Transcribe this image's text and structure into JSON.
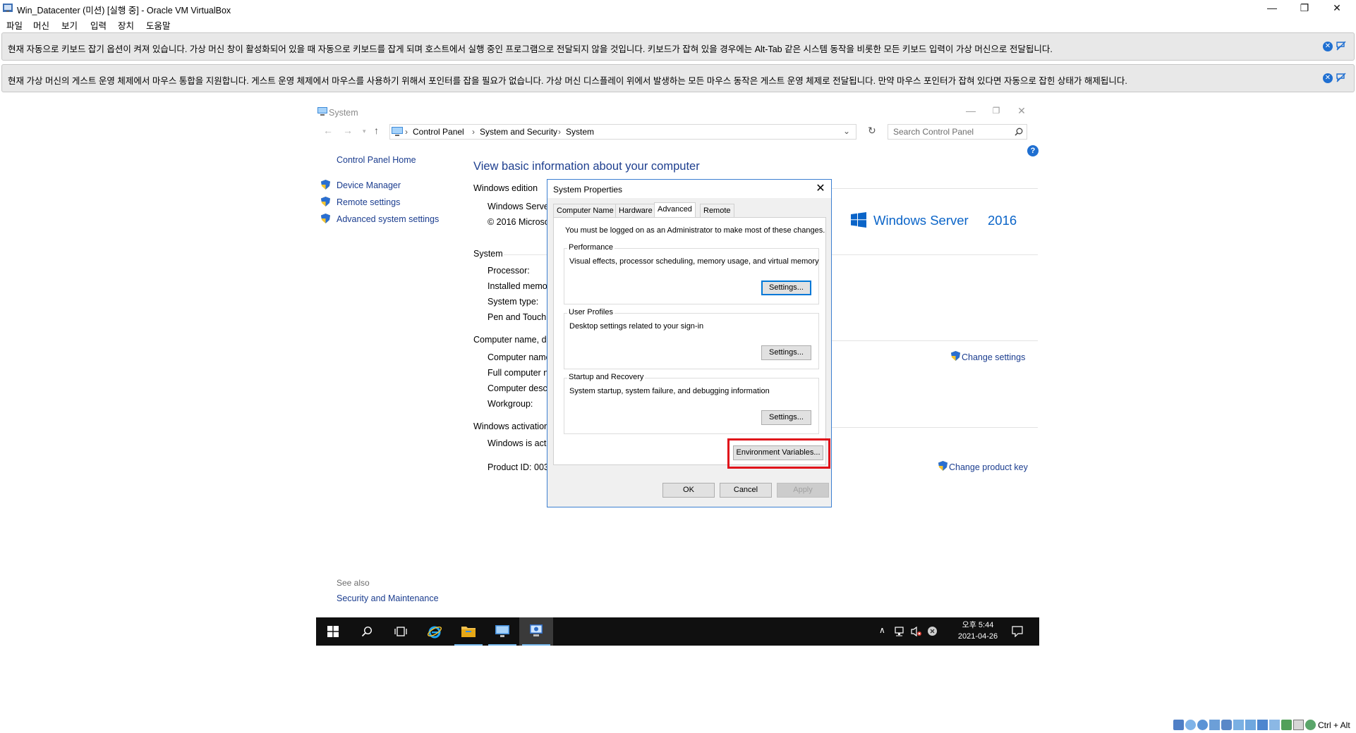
{
  "host": {
    "title": "Win_Datacenter (미션) [실행 중] - Oracle VM VirtualBox",
    "menu": [
      "파일",
      "머신",
      "보기",
      "입력",
      "장치",
      "도움말"
    ],
    "banners": [
      {
        "msg": "현재 자동으로 키보드 잡기 옵션이 켜져 있습니다. 가상 머신 창이 활성화되어 있을 때 자동으로 키보드를 잡게 되며 호스트에서 실행 중인 프로그램으로 전달되지 않을 것입니다. 키보드가 잡혀 있을 경우에는 Alt-Tab 같은 시스템 동작을 비롯한 모든 키보드 입력이 가상 머신으로 전달됩니다."
      },
      {
        "msg": "현재 가상 머신의 게스트 운영 체제에서 마우스 통합을 지원합니다. 게스트 운영 체제에서 마우스를 사용하기 위해서 포인터를 잡을 필요가 없습니다. 가상 머신 디스플레이 위에서 발생하는 모든 마우스 동작은 게스트 운영 체제로 전달됩니다. 만약 마우스 포인터가 잡혀 있다면 자동으로 잡힌 상태가 해제됩니다."
      }
    ],
    "host_key": "Ctrl + Alt"
  },
  "system_window": {
    "title": "System",
    "breadcrumb": [
      "Control Panel",
      "System and Security",
      "System"
    ],
    "search_placeholder": "Search Control Panel",
    "left_nav": {
      "home": "Control Panel Home",
      "links": [
        "Device Manager",
        "Remote settings",
        "Advanced system settings"
      ],
      "see_also_label": "See also",
      "see_also_link": "Security and Maintenance"
    },
    "heading": "View basic information about your computer",
    "edition_section": "Windows edition",
    "edition_lines": [
      "Windows Server",
      "© 2016 Microso"
    ],
    "logo_text": "Windows Server",
    "logo_version": "2016",
    "system_section": "System",
    "system_labels": [
      "Processor:",
      "Installed memo",
      "System type:",
      "Pen and Touch:"
    ],
    "computer_section": "Computer name, do",
    "computer_labels": [
      "Computer name",
      "Full computer n",
      "Computer desc",
      "Workgroup:"
    ],
    "change_settings": "Change settings",
    "activation_section": "Windows activation",
    "activation_labels": [
      "Windows is acti",
      "Product ID: 003"
    ],
    "change_key": "Change product key"
  },
  "dialog": {
    "title": "System Properties",
    "tabs": [
      "Computer Name",
      "Hardware",
      "Advanced",
      "Remote"
    ],
    "active_tab": "Advanced",
    "admin_note": "You must be logged on as an Administrator to make most of these changes.",
    "groups": [
      {
        "label": "Performance",
        "desc": "Visual effects, processor scheduling, memory usage, and virtual memory",
        "button": "Settings..."
      },
      {
        "label": "User Profiles",
        "desc": "Desktop settings related to your sign-in",
        "button": "Settings..."
      },
      {
        "label": "Startup and Recovery",
        "desc": "System startup, system failure, and debugging information",
        "button": "Settings..."
      }
    ],
    "env_button": "Environment Variables...",
    "ok": "OK",
    "cancel": "Cancel",
    "apply": "Apply",
    "highlight_color": "#e0101a"
  },
  "taskbar": {
    "time": "오후 5:44",
    "date": "2021-04-26"
  }
}
